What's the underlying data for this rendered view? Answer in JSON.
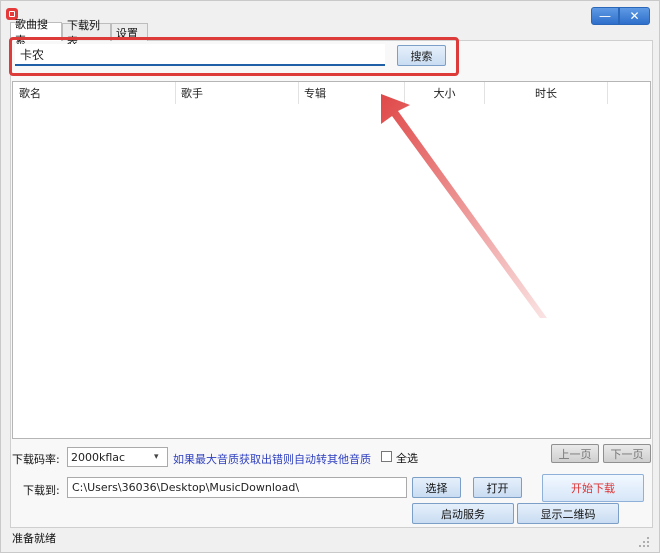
{
  "window": {
    "minimize_glyph": "—",
    "close_glyph": "✕"
  },
  "tabs": [
    "歌曲搜索",
    "下载列表",
    "设置"
  ],
  "search": {
    "query": "卡农",
    "button": "搜索"
  },
  "table": {
    "columns": [
      "歌名",
      "歌手",
      "专辑",
      "大小",
      "时长"
    ],
    "rows": []
  },
  "bitrate": {
    "label": "下载码率:",
    "selected": "2000kflac"
  },
  "hint": "如果最大音质获取出错则自动转其他音质",
  "select_all": {
    "label": "全选",
    "checked": false
  },
  "pager": {
    "prev": "上一页",
    "next": "下一页"
  },
  "download": {
    "label": "下载到:",
    "path": "C:\\Users\\36036\\Desktop\\MusicDownload\\",
    "choose": "选择",
    "open": "打开",
    "start": "开始下载",
    "service": "启动服务",
    "qrcode": "显示二维码"
  },
  "status": "准备就绪",
  "colors": {
    "highlight": "#dd3a3a",
    "accent": "#1e5fa8",
    "hint": "#2e3fbf",
    "start_text": "#d33333"
  },
  "icons": {
    "app": "app-icon",
    "arrow": "red-arrow-annotation",
    "chevron": "chevron-down-icon",
    "grip": "resize-grip-icon"
  }
}
